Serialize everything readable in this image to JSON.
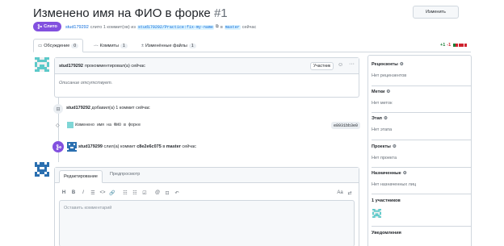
{
  "header": {
    "title": "Изменено имя на ФИО в форке",
    "number": "#1",
    "edit_label": "Изменить"
  },
  "status": {
    "badge": "Слито",
    "author": "stud179292",
    "text_merged": "слито 1 коммит(ов) из",
    "source_branch": "stud179292/Practice:fix-my-name",
    "into": "в",
    "target_branch": "master",
    "time": "сейчас"
  },
  "tabs": [
    {
      "label": "Обсуждение",
      "count": "0"
    },
    {
      "label": "Коммиты",
      "count": "1"
    },
    {
      "label": "Изменённые файлы",
      "count": "1"
    }
  ],
  "diffstat": {
    "added": "+1",
    "removed": "-1"
  },
  "comment": {
    "author": "stud179292",
    "action": "прокомментировал(а) сейчас",
    "role": "Участник",
    "body": "Описание отсутствует."
  },
  "timeline": {
    "commit_event": {
      "author": "stud179292",
      "text": "добавил(а) 1 коммит сейчас"
    },
    "commit": {
      "message": "Изменено имя на ФИО в форке",
      "sha": "e8931bb3e0"
    },
    "merge_event": {
      "author": "stud179299",
      "text": "слил(а) коммит",
      "sha": "c8e2e6c075",
      "into": "в",
      "branch": "master",
      "time": "сейчас"
    }
  },
  "editor": {
    "tab_write": "Редактирование",
    "tab_preview": "Предпросмотр",
    "placeholder": "Оставить комментарий",
    "toolbar_aa": "Aa"
  },
  "sidebar": {
    "reviewers": {
      "title": "Рецензенты",
      "value": "Нет рецензентов"
    },
    "labels": {
      "title": "Метки",
      "value": "Нет меток"
    },
    "milestone": {
      "title": "Этап",
      "value": "Нет этапа"
    },
    "projects": {
      "title": "Проекты",
      "value": "Нет проекта"
    },
    "assignees": {
      "title": "Назначенные",
      "value": "Нет назначенных лиц"
    },
    "participants": {
      "title": "1 участников"
    },
    "notifications": {
      "title": "Уведомления"
    }
  },
  "colors": {
    "accent": "#0969da",
    "merged": "#8250df",
    "add": "#1a7f37",
    "del": "#cf222e"
  }
}
